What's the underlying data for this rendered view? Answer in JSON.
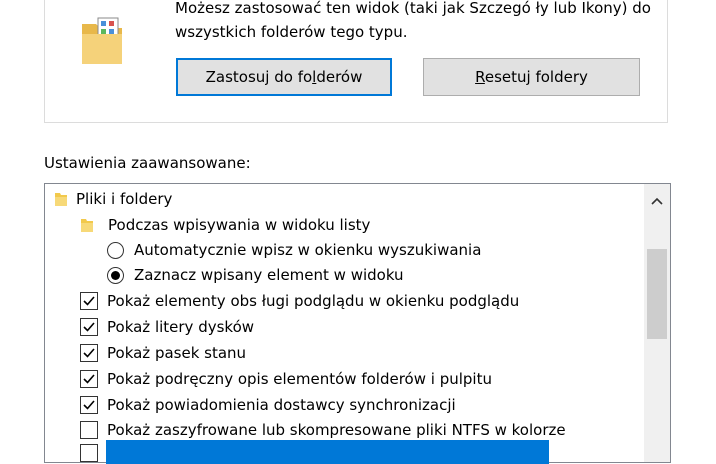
{
  "view_section": {
    "description": "Możesz zastosować ten widok (taki jak Szczegó ły lub Ikony) do wszystkich folderów tego typu.",
    "apply_button": "Zastosuj do folderów",
    "reset_button": "Resetuj foldery"
  },
  "advanced": {
    "label": "Ustawienia zaawansowane:",
    "items": [
      {
        "type": "folder",
        "label": "Pliki i foldery",
        "level": 0
      },
      {
        "type": "folder",
        "label": "Podczas wpisywania w widoku listy",
        "level": 1
      },
      {
        "type": "radio",
        "label": "Automatycznie wpisz w okienku wyszukiwania",
        "checked": false,
        "level": 2
      },
      {
        "type": "radio",
        "label": "Zaznacz wpisany element w widoku",
        "checked": true,
        "level": 2
      },
      {
        "type": "checkbox",
        "label": "Pokaż elementy obs ługi podglądu w okienku podglądu",
        "checked": true,
        "level": 1
      },
      {
        "type": "checkbox",
        "label": "Pokaż litery dysków",
        "checked": true,
        "level": 1
      },
      {
        "type": "checkbox",
        "label": "Pokaż pasek stanu",
        "checked": true,
        "level": 1
      },
      {
        "type": "checkbox",
        "label": "Pokaż podręczny opis elementów folderów i pulpitu",
        "checked": true,
        "level": 1
      },
      {
        "type": "checkbox",
        "label": "Pokaż powiadomienia dostawcy synchronizacji",
        "checked": true,
        "level": 1
      },
      {
        "type": "checkbox",
        "label": "Pokaż zaszyfrowane lub skompresowane pliki NTFS w kolorze",
        "checked": false,
        "level": 1
      }
    ]
  },
  "colors": {
    "accent": "#0078d7",
    "folder": "#f2c94c"
  }
}
